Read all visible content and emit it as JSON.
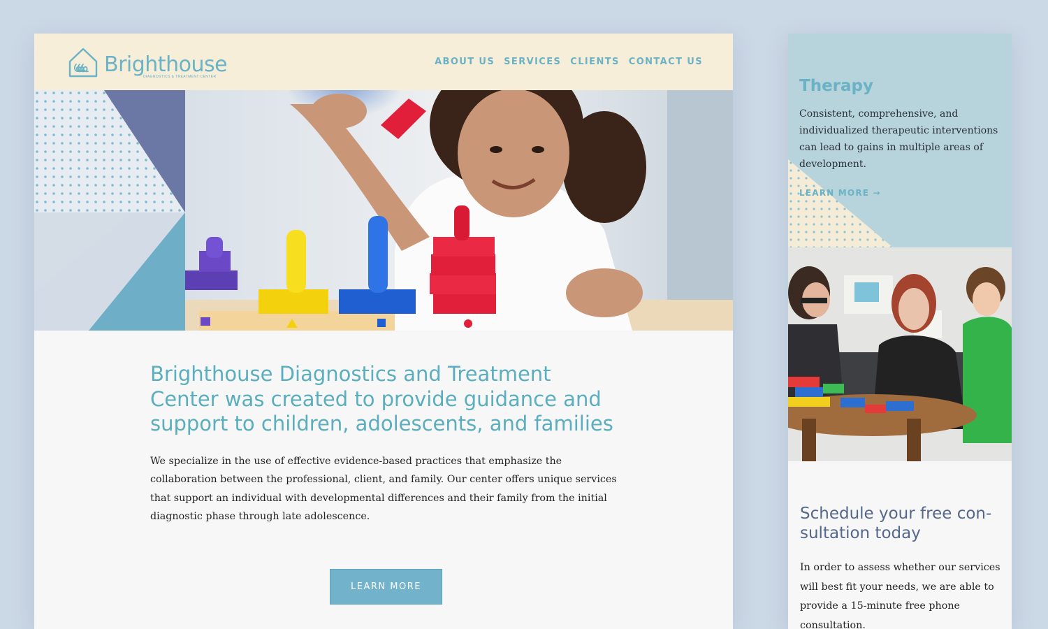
{
  "brand": {
    "name": "Brighthouse",
    "tagline": "Diagnostics & Treatment Center"
  },
  "nav": {
    "items": [
      "ABOUT US",
      "SERVICES",
      "CLIENTS",
      "CONTACT US"
    ]
  },
  "hero": {
    "headline": "Brighthouse Diagnostics and Treatment Center was created to provide guidance and support to children, adolescents, and families",
    "body": "We specialize in the use of effective evidence-based practices that emphasize the collaboration between the professional, client, and family.  Our center offers unique services that support an individual with developmental differences and their family from the initial diagnostic phase through late adolescence.",
    "cta_label": "LEARN MORE"
  },
  "therapy": {
    "title": "Therapy",
    "text": "Consistent, comprehensive, and individualized therapeutic interventions can lead to gains in multiple areas of development.",
    "link_label": "LEARN MORE →"
  },
  "schedule": {
    "title": "Schedule your free con-sultation today",
    "text": "In order to assess whether our services will best fit your needs, we are able to provide a 15-minute free phone consultation."
  },
  "colors": {
    "accent": "#6ab2c5",
    "header_bg": "#f7eed9",
    "page_bg": "#cbd8e6",
    "button": "#72b3cb",
    "therapy_bg": "#b7d3dc",
    "slate": "#56678c"
  }
}
